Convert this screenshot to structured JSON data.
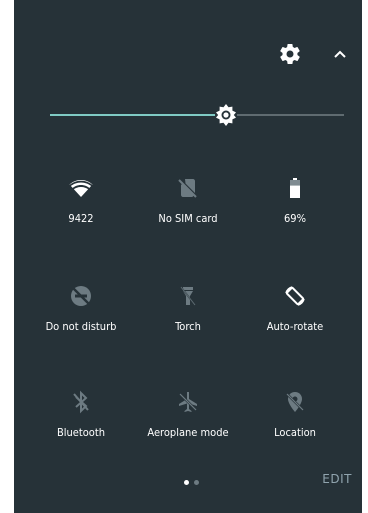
{
  "tiles": [
    {
      "label": "9422",
      "icon": "wifi-icon"
    },
    {
      "label": "No SIM card",
      "icon": "no-sim-icon"
    },
    {
      "label": "69%",
      "icon": "battery-icon"
    },
    {
      "label": "Do not disturb",
      "icon": "do-not-disturb-icon"
    },
    {
      "label": "Torch",
      "icon": "torch-icon"
    },
    {
      "label": "Auto-rotate",
      "icon": "auto-rotate-icon"
    },
    {
      "label": "Bluetooth",
      "icon": "bluetooth-icon"
    },
    {
      "label": "Aeroplane mode",
      "icon": "aeroplane-icon"
    },
    {
      "label": "Location",
      "icon": "location-icon"
    }
  ],
  "brightness": {
    "level_percent": 60
  },
  "battery": {
    "level_percent": 69
  },
  "pager": {
    "active_index": 0,
    "count": 2
  },
  "edit_label": "EDIT",
  "colors": {
    "panel": "#263238",
    "accent": "#80cbc4",
    "active_icon": "#ffffff",
    "inactive_icon": "#6d7b82"
  }
}
